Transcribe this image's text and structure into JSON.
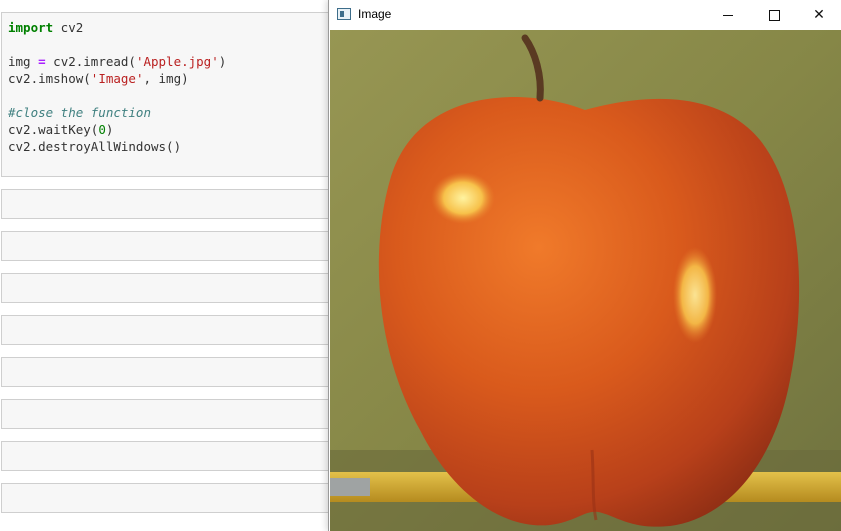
{
  "notebook": {
    "code_lines": [
      [
        {
          "t": "import",
          "c": "kw"
        },
        {
          "t": " cv2",
          "c": ""
        }
      ],
      [],
      [
        {
          "t": "img ",
          "c": ""
        },
        {
          "t": "=",
          "c": "op"
        },
        {
          "t": " cv2.imread(",
          "c": ""
        },
        {
          "t": "'Apple.jpg'",
          "c": "str"
        },
        {
          "t": ")",
          "c": ""
        }
      ],
      [
        {
          "t": "cv2.imshow(",
          "c": ""
        },
        {
          "t": "'Image'",
          "c": "str"
        },
        {
          "t": ", img)",
          "c": ""
        }
      ],
      [],
      [
        {
          "t": "#close the function",
          "c": "cm"
        }
      ],
      [
        {
          "t": "cv2.waitKey(",
          "c": ""
        },
        {
          "t": "0",
          "c": "num"
        },
        {
          "t": ")",
          "c": ""
        }
      ],
      [
        {
          "t": "cv2.destroyAllWindows()",
          "c": ""
        }
      ]
    ],
    "empty_cell_count": 8
  },
  "window": {
    "title": "Image",
    "icon": "window-app-icon",
    "controls": [
      "minimize-icon",
      "maximize-icon",
      "close-icon"
    ],
    "image": "red apple in front of a green background with a yellow pencil"
  },
  "colors": {
    "keyword": "#008000",
    "string": "#ba2121",
    "comment": "#408080",
    "operator": "#aa22ff",
    "cell_bg": "#f7f7f7",
    "cell_border": "#cfcfcf"
  }
}
